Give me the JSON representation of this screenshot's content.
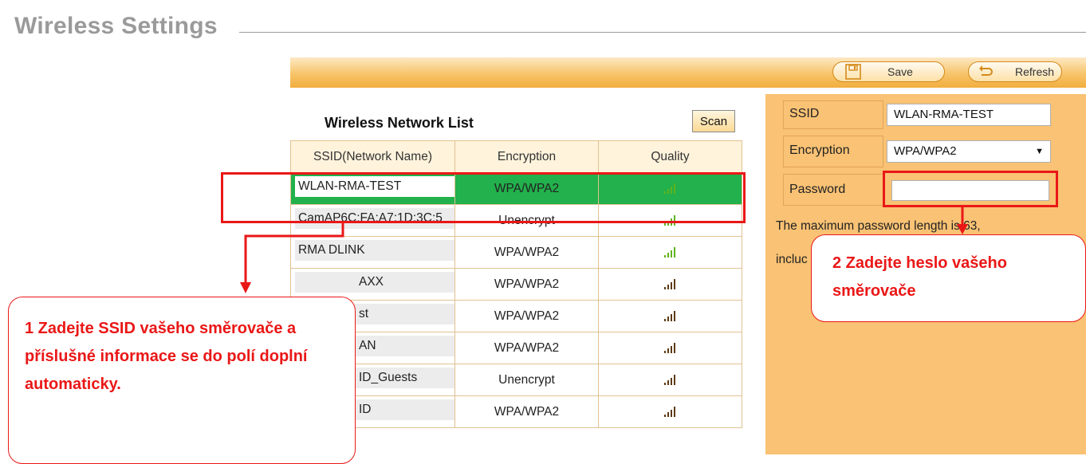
{
  "header": {
    "title": "Wireless Settings"
  },
  "toolbar": {
    "save_label": "Save",
    "refresh_label": "Refresh"
  },
  "network_list": {
    "title": "Wireless Network List",
    "scan_label": "Scan",
    "columns": [
      "SSID(Network Name)",
      "Encryption",
      "Quality"
    ],
    "rows": [
      {
        "ssid": "WLAN-RMA-TEST",
        "encryption": "WPA/WPA2",
        "quality_icon": "signal-bars-green"
      },
      {
        "ssid": "CamAP6C:FA:A7:1D:3C:5",
        "encryption": "Unencrypt",
        "quality_icon": "signal-bars-green"
      },
      {
        "ssid": "RMA DLINK",
        "encryption": "WPA/WPA2",
        "quality_icon": "signal-bars-green"
      },
      {
        "ssid": "AXX",
        "encryption": "WPA/WPA2",
        "quality_icon": "signal-bars-dark"
      },
      {
        "ssid": "st",
        "encryption": "WPA/WPA2",
        "quality_icon": "signal-bars-dark"
      },
      {
        "ssid": "AN",
        "encryption": "WPA/WPA2",
        "quality_icon": "signal-bars-dark"
      },
      {
        "ssid": "ID_Guests",
        "encryption": "Unencrypt",
        "quality_icon": "signal-bars-dark"
      },
      {
        "ssid": "ID",
        "encryption": "WPA/WPA2",
        "quality_icon": "signal-bars-dark"
      }
    ],
    "selected_index": 0
  },
  "form": {
    "ssid_label": "SSID",
    "ssid_value": "WLAN-RMA-TEST",
    "encryption_label": "Encryption",
    "encryption_value": "WPA/WPA2",
    "password_label": "Password",
    "password_value": "",
    "info_line1": "The maximum password length is 63,",
    "info_line2": "incluc"
  },
  "annotations": {
    "callout1": "1 Zadejte SSID vašeho směrovače a příslušné informace se do polí doplní automaticky.",
    "callout2": "2 Zadejte heslo vašeho směrovače"
  },
  "colors": {
    "toolbar": "#f4b552",
    "form_panel": "#f9c274",
    "selected_row": "#22b14c",
    "annotation_red": "#ea1717",
    "title_gray": "#9a9a9a"
  }
}
